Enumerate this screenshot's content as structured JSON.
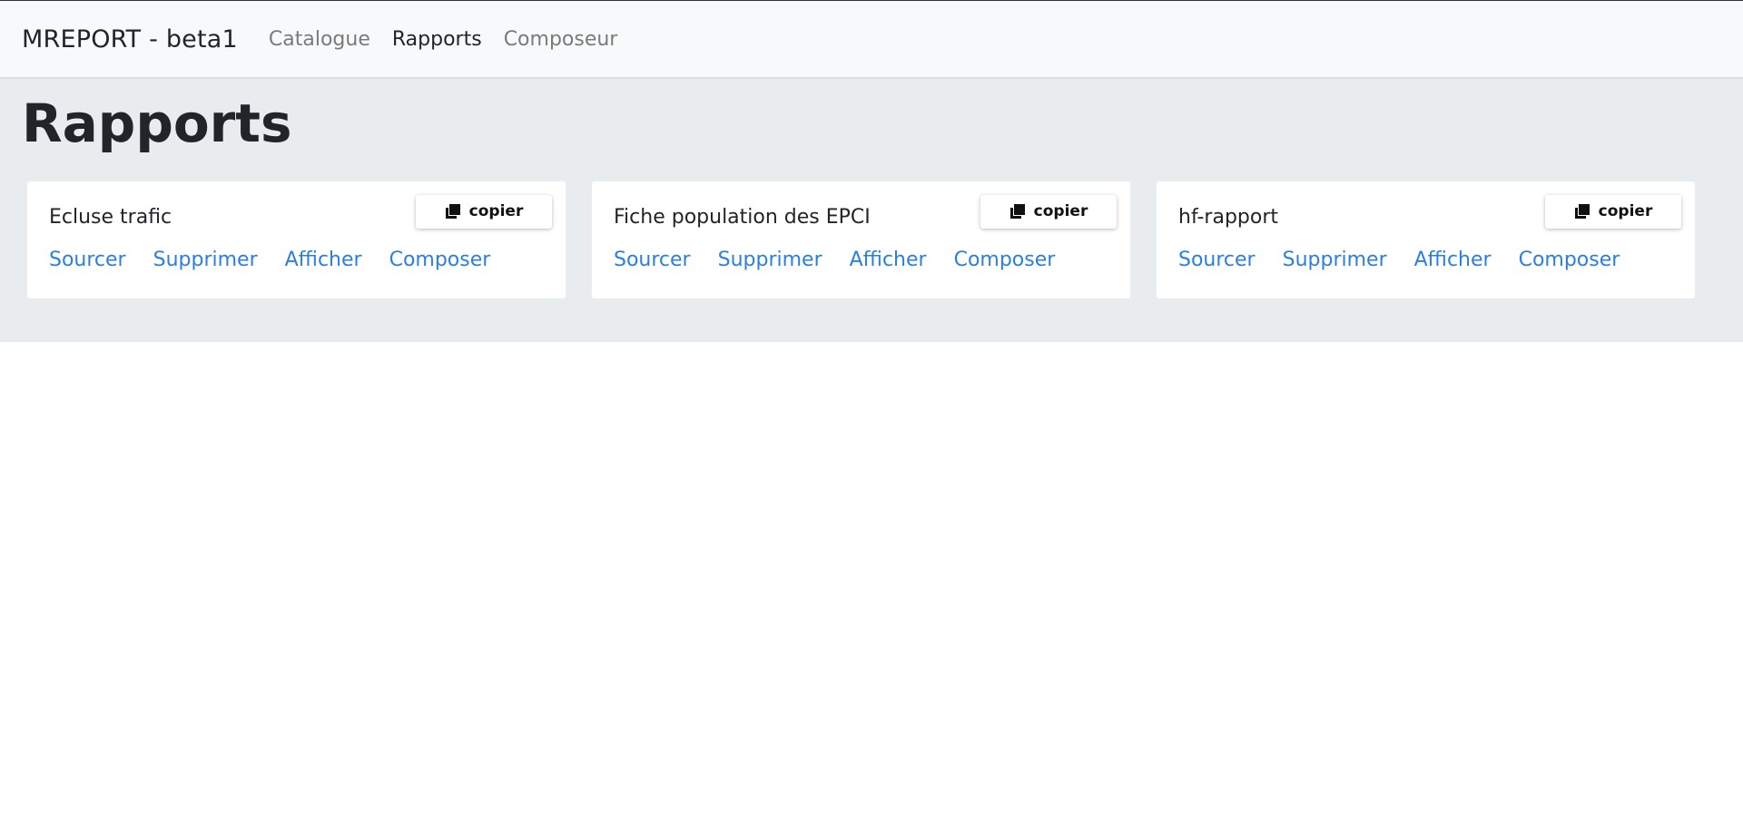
{
  "navbar": {
    "brand": "MREPORT - beta1",
    "links": [
      {
        "label": "Catalogue",
        "active": false
      },
      {
        "label": "Rapports",
        "active": true
      },
      {
        "label": "Composeur",
        "active": false
      }
    ]
  },
  "main": {
    "title": "Rapports",
    "cards": [
      {
        "title": "Ecluse trafic",
        "copy_label": "copier",
        "actions": [
          "Sourcer",
          "Supprimer",
          "Afficher",
          "Composer"
        ]
      },
      {
        "title": "Fiche population des EPCI",
        "copy_label": "copier",
        "actions": [
          "Sourcer",
          "Supprimer",
          "Afficher",
          "Composer"
        ]
      },
      {
        "title": "hf-rapport",
        "copy_label": "copier",
        "actions": [
          "Sourcer",
          "Supprimer",
          "Afficher",
          "Composer"
        ]
      }
    ]
  },
  "colors": {
    "link": "#2a7fe3",
    "navbar_bg": "#f8f9fa",
    "jumbotron_bg": "#e9ecef"
  },
  "icons": {
    "copy": "copy-icon"
  }
}
